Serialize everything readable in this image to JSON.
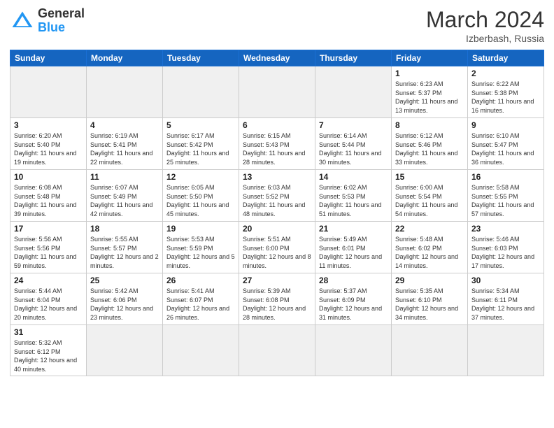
{
  "header": {
    "logo_general": "General",
    "logo_blue": "Blue",
    "title": "March 2024",
    "location": "Izberbash, Russia"
  },
  "weekdays": [
    "Sunday",
    "Monday",
    "Tuesday",
    "Wednesday",
    "Thursday",
    "Friday",
    "Saturday"
  ],
  "days": {
    "1": {
      "sunrise": "6:23 AM",
      "sunset": "5:37 PM",
      "daylight": "11 hours and 13 minutes."
    },
    "2": {
      "sunrise": "6:22 AM",
      "sunset": "5:38 PM",
      "daylight": "11 hours and 16 minutes."
    },
    "3": {
      "sunrise": "6:20 AM",
      "sunset": "5:40 PM",
      "daylight": "11 hours and 19 minutes."
    },
    "4": {
      "sunrise": "6:19 AM",
      "sunset": "5:41 PM",
      "daylight": "11 hours and 22 minutes."
    },
    "5": {
      "sunrise": "6:17 AM",
      "sunset": "5:42 PM",
      "daylight": "11 hours and 25 minutes."
    },
    "6": {
      "sunrise": "6:15 AM",
      "sunset": "5:43 PM",
      "daylight": "11 hours and 28 minutes."
    },
    "7": {
      "sunrise": "6:14 AM",
      "sunset": "5:44 PM",
      "daylight": "11 hours and 30 minutes."
    },
    "8": {
      "sunrise": "6:12 AM",
      "sunset": "5:46 PM",
      "daylight": "11 hours and 33 minutes."
    },
    "9": {
      "sunrise": "6:10 AM",
      "sunset": "5:47 PM",
      "daylight": "11 hours and 36 minutes."
    },
    "10": {
      "sunrise": "6:08 AM",
      "sunset": "5:48 PM",
      "daylight": "11 hours and 39 minutes."
    },
    "11": {
      "sunrise": "6:07 AM",
      "sunset": "5:49 PM",
      "daylight": "11 hours and 42 minutes."
    },
    "12": {
      "sunrise": "6:05 AM",
      "sunset": "5:50 PM",
      "daylight": "11 hours and 45 minutes."
    },
    "13": {
      "sunrise": "6:03 AM",
      "sunset": "5:52 PM",
      "daylight": "11 hours and 48 minutes."
    },
    "14": {
      "sunrise": "6:02 AM",
      "sunset": "5:53 PM",
      "daylight": "11 hours and 51 minutes."
    },
    "15": {
      "sunrise": "6:00 AM",
      "sunset": "5:54 PM",
      "daylight": "11 hours and 54 minutes."
    },
    "16": {
      "sunrise": "5:58 AM",
      "sunset": "5:55 PM",
      "daylight": "11 hours and 57 minutes."
    },
    "17": {
      "sunrise": "5:56 AM",
      "sunset": "5:56 PM",
      "daylight": "11 hours and 59 minutes."
    },
    "18": {
      "sunrise": "5:55 AM",
      "sunset": "5:57 PM",
      "daylight": "12 hours and 2 minutes."
    },
    "19": {
      "sunrise": "5:53 AM",
      "sunset": "5:59 PM",
      "daylight": "12 hours and 5 minutes."
    },
    "20": {
      "sunrise": "5:51 AM",
      "sunset": "6:00 PM",
      "daylight": "12 hours and 8 minutes."
    },
    "21": {
      "sunrise": "5:49 AM",
      "sunset": "6:01 PM",
      "daylight": "12 hours and 11 minutes."
    },
    "22": {
      "sunrise": "5:48 AM",
      "sunset": "6:02 PM",
      "daylight": "12 hours and 14 minutes."
    },
    "23": {
      "sunrise": "5:46 AM",
      "sunset": "6:03 PM",
      "daylight": "12 hours and 17 minutes."
    },
    "24": {
      "sunrise": "5:44 AM",
      "sunset": "6:04 PM",
      "daylight": "12 hours and 20 minutes."
    },
    "25": {
      "sunrise": "5:42 AM",
      "sunset": "6:06 PM",
      "daylight": "12 hours and 23 minutes."
    },
    "26": {
      "sunrise": "5:41 AM",
      "sunset": "6:07 PM",
      "daylight": "12 hours and 26 minutes."
    },
    "27": {
      "sunrise": "5:39 AM",
      "sunset": "6:08 PM",
      "daylight": "12 hours and 28 minutes."
    },
    "28": {
      "sunrise": "5:37 AM",
      "sunset": "6:09 PM",
      "daylight": "12 hours and 31 minutes."
    },
    "29": {
      "sunrise": "5:35 AM",
      "sunset": "6:10 PM",
      "daylight": "12 hours and 34 minutes."
    },
    "30": {
      "sunrise": "5:34 AM",
      "sunset": "6:11 PM",
      "daylight": "12 hours and 37 minutes."
    },
    "31": {
      "sunrise": "5:32 AM",
      "sunset": "6:12 PM",
      "daylight": "12 hours and 40 minutes."
    }
  }
}
